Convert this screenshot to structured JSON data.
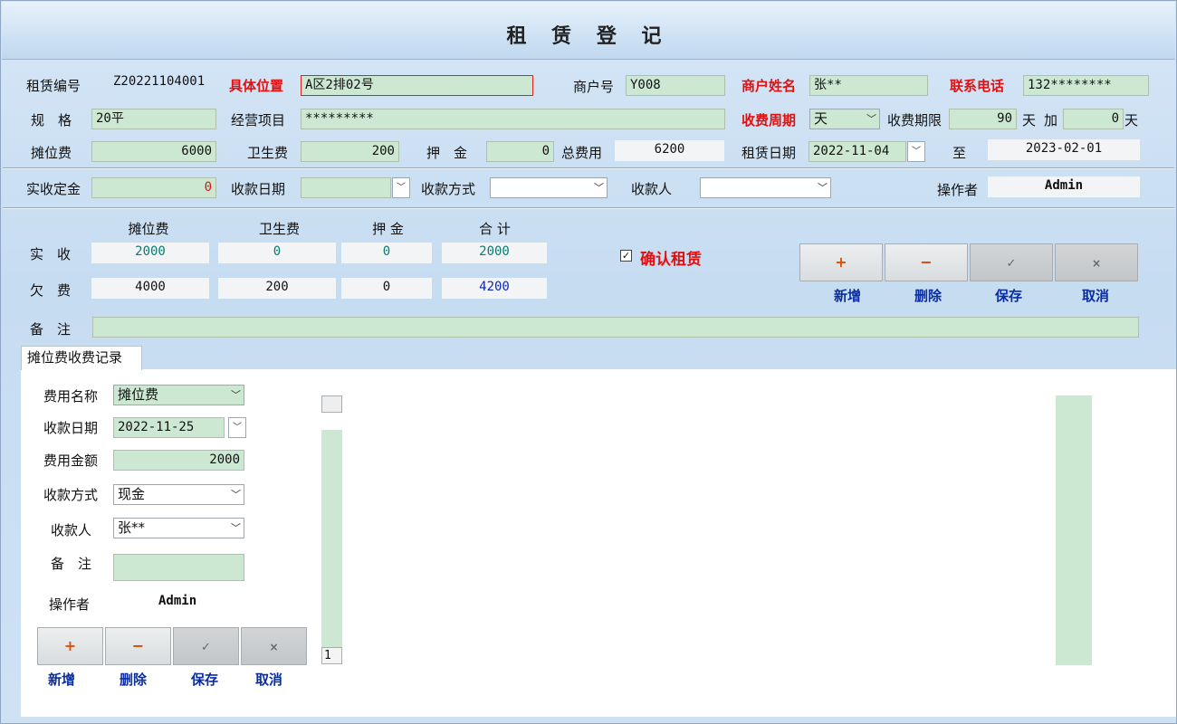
{
  "title": "租 赁 登 记",
  "row1": {
    "rental_no_label": "租赁编号",
    "rental_no": "Z20221104001",
    "location_label": "具体位置",
    "location": "A区2排02号",
    "merchant_no_label": "商户号",
    "merchant_no": "Y008",
    "merchant_name_label": "商户姓名",
    "merchant_name": "张**",
    "phone_label": "联系电话",
    "phone": "132********"
  },
  "row2": {
    "spec_label": "规　格",
    "spec": "20平",
    "business_label": "经营项目",
    "business": "*********",
    "cycle_label": "收费周期",
    "cycle": "天",
    "period_label": "收费期限",
    "period": "90",
    "day_unit": "天",
    "plus_label": "加",
    "extra": "0",
    "day_unit2": "天"
  },
  "row3": {
    "booth_fee_label": "摊位费",
    "booth_fee": "6000",
    "sanitation_label": "卫生费",
    "sanitation": "200",
    "deposit_label": "押　金",
    "deposit": "0",
    "total_label": "总费用",
    "total": "6200",
    "rent_date_label": "租赁日期",
    "rent_date": "2022-11-04",
    "to_label": "至",
    "end_date": "2023-02-01"
  },
  "row4": {
    "received_deposit_label": "实收定金",
    "received_deposit": "0",
    "pay_date_label": "收款日期",
    "pay_date": "",
    "pay_method_label": "收款方式",
    "pay_method": "",
    "payee_label": "收款人",
    "payee": "",
    "operator_label": "操作者",
    "operator": "Admin"
  },
  "summary": {
    "col_headers": [
      "摊位费",
      "卫生费",
      "押 金",
      "合 计"
    ],
    "received_label": "实　收",
    "received": [
      "2000",
      "0",
      "0",
      "2000"
    ],
    "owed_label": "欠　费",
    "owed": [
      "4000",
      "200",
      "0",
      "4200"
    ],
    "confirm_label": "确认租赁",
    "confirm_mark": "☑",
    "remark_label": "备　注",
    "remark": ""
  },
  "top_buttons": {
    "add_symbol": "+",
    "add_label": "新增",
    "delete_symbol": "−",
    "delete_label": "删除",
    "save_symbol": "✓",
    "save_label": "保存",
    "cancel_symbol": "×",
    "cancel_label": "取消"
  },
  "tab": {
    "label": "摊位费收费记录"
  },
  "record_form": {
    "fee_name_label": "费用名称",
    "fee_name": "摊位费",
    "pay_date_label": "收款日期",
    "pay_date": "2022-11-25",
    "amount_label": "费用金额",
    "amount": "2000",
    "method_label": "收款方式",
    "method": "现金",
    "payee_label": "收款人",
    "payee": "张**",
    "remark_label": "备　注",
    "remark": "",
    "operator_label": "操作者",
    "operator": "Admin"
  },
  "bottom_buttons": {
    "add_symbol": "+",
    "add_label": "新增",
    "delete_symbol": "−",
    "delete_label": "删除",
    "save_symbol": "✓",
    "save_label": "保存",
    "cancel_symbol": "×",
    "cancel_label": "取消"
  },
  "grid": {
    "row_number": "1"
  },
  "icons": {
    "dropdown": "chevron-down-icon",
    "checkbox": "checkbox-checked-icon"
  },
  "colors": {
    "field_green": "#cde8d2",
    "required_red": "#e01010",
    "action_blue": "#0a2ea0",
    "window_blue": "#c6dcf1"
  }
}
